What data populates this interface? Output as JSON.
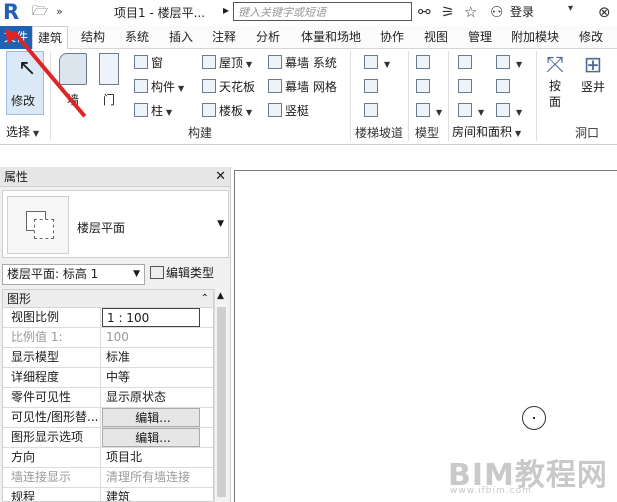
{
  "titlebar": {
    "logo": "R",
    "title": "项目1 - 楼层平...",
    "search_placeholder": "键入关键字或短语",
    "login": "登录"
  },
  "menu": {
    "file": "文件",
    "tabs": [
      "建筑",
      "结构",
      "系统",
      "插入",
      "注释",
      "分析",
      "体量和场地",
      "协作",
      "视图",
      "管理",
      "附加模块",
      "修改"
    ]
  },
  "ribbon": {
    "modify": "修改",
    "select": "选择",
    "wall": "墙",
    "door": "门",
    "window": "窗",
    "component": "构件",
    "column": "柱",
    "roof": "屋顶",
    "ceiling": "天花板",
    "floor": "楼板",
    "curtain_system": "幕墙 系统",
    "curtain_grid": "幕墙 网格",
    "mullion": "竖梃",
    "build_label": "构建",
    "stairs_label": "楼梯坡道",
    "model_label": "模型",
    "room_label": "房间和面积",
    "opening_label": "洞口",
    "by_face": "按面",
    "shaft": "竖井"
  },
  "properties": {
    "title": "属性",
    "type_name": "楼层平面",
    "selector": "楼层平面: 标高 1",
    "edit_type": "编辑类型",
    "section": "图形",
    "rows": [
      {
        "label": "视图比例",
        "value": "1 : 100"
      },
      {
        "label": "比例值 1:",
        "value": "100"
      },
      {
        "label": "显示模型",
        "value": "标准"
      },
      {
        "label": "详细程度",
        "value": "中等"
      },
      {
        "label": "零件可见性",
        "value": "显示原状态"
      },
      {
        "label": "可见性/图形替...",
        "value": "编辑..."
      },
      {
        "label": "图形显示选项",
        "value": "编辑..."
      },
      {
        "label": "方向",
        "value": "项目北"
      },
      {
        "label": "墙连接显示",
        "value": "清理所有墙连接"
      },
      {
        "label": "规程",
        "value": "建筑"
      }
    ]
  },
  "watermark": {
    "text": "BIM教程网",
    "url": "www.ifbim.com"
  }
}
